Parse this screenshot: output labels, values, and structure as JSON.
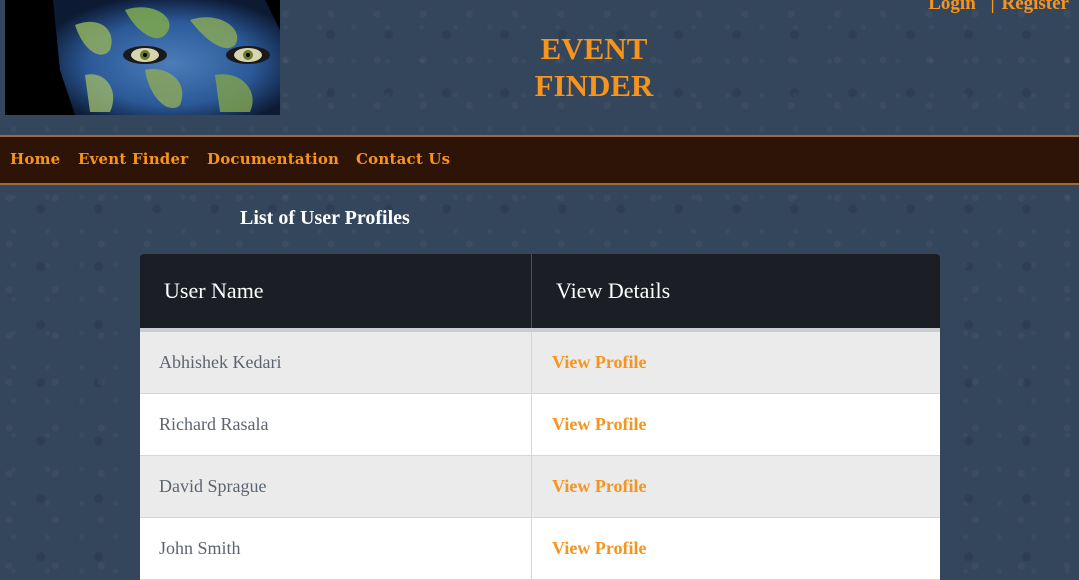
{
  "header": {
    "site_title_line1": "EVENT",
    "site_title_line2": "FINDER",
    "login_label": "Login",
    "separator": "|",
    "register_label": "Register"
  },
  "nav": {
    "items": [
      {
        "label": "Home"
      },
      {
        "label": "Event Finder"
      },
      {
        "label": "Documentation"
      },
      {
        "label": "Contact Us"
      }
    ]
  },
  "main": {
    "title": "List of User Profiles",
    "table": {
      "headers": [
        "User Name",
        "View Details"
      ],
      "rows": [
        {
          "name": "Abhishek Kedari",
          "action": "View Profile"
        },
        {
          "name": "Richard Rasala",
          "action": "View Profile"
        },
        {
          "name": "David Sprague",
          "action": "View Profile"
        },
        {
          "name": "John Smith",
          "action": "View Profile"
        }
      ]
    }
  },
  "colors": {
    "accent": "#f7941d",
    "navbar_bg": "#2d1406",
    "page_bg": "#34465c",
    "table_header_bg": "#1b1e24"
  }
}
